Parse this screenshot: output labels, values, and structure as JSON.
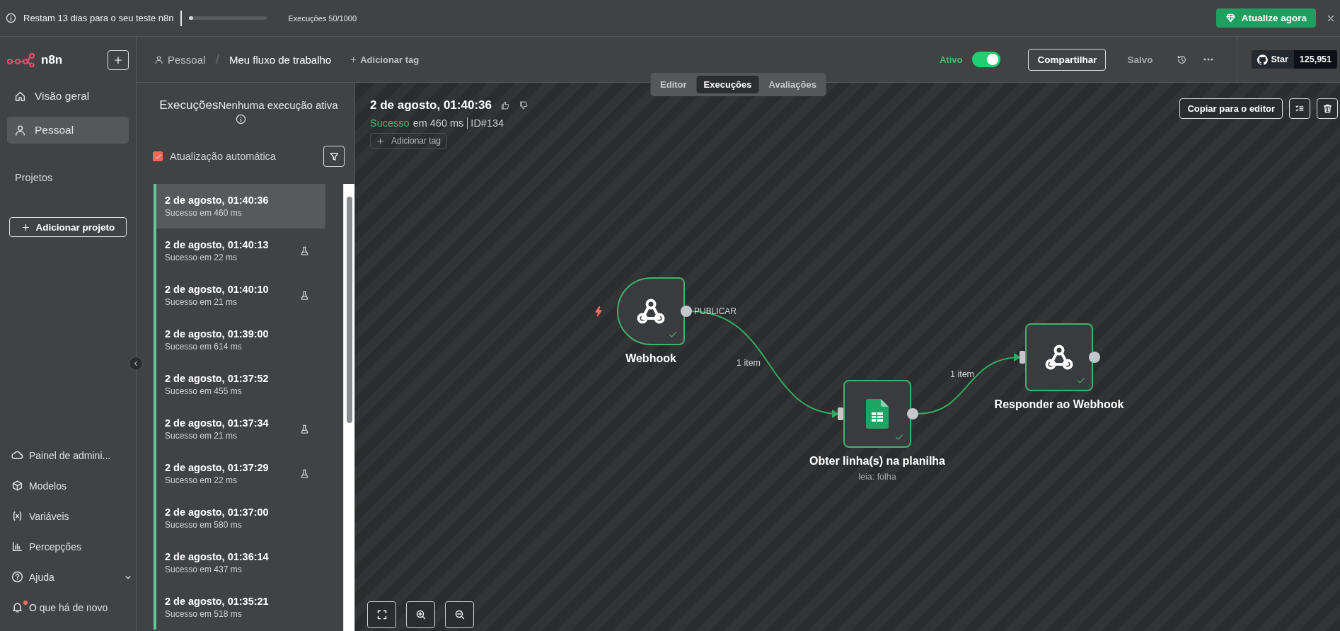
{
  "banner": {
    "message": "Restam 13 dias para o seu teste n8n",
    "usage": {
      "level": 0.05
    },
    "usage_label": "Execuções 50/1000",
    "upgrade_button": "Atualize agora"
  },
  "sidebar": {
    "logo": "n8n",
    "nav": [
      {
        "label": "Visão geral",
        "selected": false
      },
      {
        "label": "Pessoal",
        "selected": true
      }
    ],
    "projects_heading": "Projetos",
    "add_project": "Adicionar projeto",
    "bottom": [
      {
        "label": "Painel de admini...",
        "has_submenu": false,
        "has_badge": false
      },
      {
        "label": "Modelos",
        "has_submenu": false,
        "has_badge": false
      },
      {
        "label": "Variáveis",
        "has_submenu": false,
        "has_badge": false
      },
      {
        "label": "Percepções",
        "has_submenu": false,
        "has_badge": false
      },
      {
        "label": "Ajuda",
        "has_submenu": true,
        "has_badge": false
      },
      {
        "label": "O que há de novo",
        "has_submenu": false,
        "has_badge": true
      }
    ]
  },
  "header": {
    "project": "Pessoal",
    "separator": "/",
    "workflow": "Meu fluxo de trabalho",
    "add_tag": "Adicionar tag",
    "active_label": "Ativo",
    "active": true,
    "share_button": "Compartilhar",
    "save_state": "Salvo",
    "github": {
      "label": "Star",
      "count": "125,951"
    }
  },
  "view_tabs": [
    {
      "label": "Editor",
      "selected": false
    },
    {
      "label": "Execuções",
      "selected": true
    },
    {
      "label": "Avaliações",
      "selected": false
    }
  ],
  "executions": {
    "title": "Execuções",
    "subtitle": "Nenhuma execução ativa",
    "auto_refresh": {
      "label": "Atualização automática",
      "checked": true
    },
    "items": [
      {
        "title": "2 de agosto, 01:40:36",
        "subtitle": "Sucesso em 460 ms",
        "color": "#5eca94",
        "selected": true,
        "test": false
      },
      {
        "title": "2 de agosto, 01:40:13",
        "subtitle": "Sucesso em 22 ms",
        "color": "#5eca94",
        "selected": false,
        "test": true
      },
      {
        "title": "2 de agosto, 01:40:10",
        "subtitle": "Sucesso em 21 ms",
        "color": "#5eca94",
        "selected": false,
        "test": true
      },
      {
        "title": "2 de agosto, 01:39:00",
        "subtitle": "Sucesso em 614 ms",
        "color": "#5eca94",
        "selected": false,
        "test": false
      },
      {
        "title": "2 de agosto, 01:37:52",
        "subtitle": "Sucesso em 455 ms",
        "color": "#5eca94",
        "selected": false,
        "test": false
      },
      {
        "title": "2 de agosto, 01:37:34",
        "subtitle": "Sucesso em 21 ms",
        "color": "#5eca94",
        "selected": false,
        "test": true
      },
      {
        "title": "2 de agosto, 01:37:29",
        "subtitle": "Sucesso em 22 ms",
        "color": "#5eca94",
        "selected": false,
        "test": true
      },
      {
        "title": "2 de agosto, 01:37:00",
        "subtitle": "Sucesso em 580 ms",
        "color": "#5eca94",
        "selected": false,
        "test": false
      },
      {
        "title": "2 de agosto, 01:36:14",
        "subtitle": "Sucesso em 437 ms",
        "color": "#5eca94",
        "selected": false,
        "test": false
      },
      {
        "title": "2 de agosto, 01:35:21",
        "subtitle": "Sucesso em 518 ms",
        "color": "#5eca94",
        "selected": false,
        "test": false
      }
    ]
  },
  "detail": {
    "title": "2 de agosto, 01:40:36",
    "status": "Sucesso",
    "duration": "em 460 ms",
    "id": "ID#134",
    "add_tag": "Adicionar tag",
    "copy_button": "Copiar para o editor"
  },
  "workflow": {
    "nodes": [
      {
        "name": "Webhook",
        "kind": "trigger",
        "success": true,
        "output_label": "PUBLICAR"
      },
      {
        "name": "Obter linha(s) na planilha",
        "subtitle": "leia: folha",
        "kind": "sheets",
        "success": true
      },
      {
        "name": "Responder ao Webhook",
        "kind": "webhook",
        "success": true
      }
    ],
    "connections": [
      {
        "label": "1 item"
      },
      {
        "label": "1 item"
      }
    ]
  }
}
